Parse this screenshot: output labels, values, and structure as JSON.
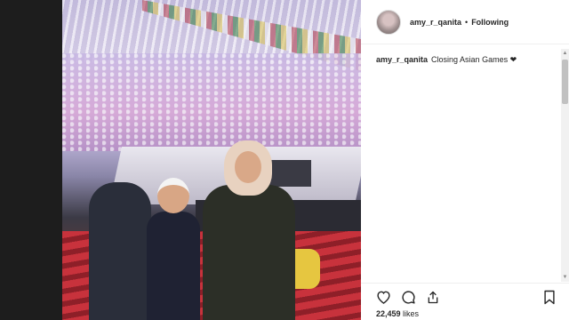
{
  "post": {
    "username": "amy_r_qanita",
    "separator": "•",
    "follow_status": "Following",
    "caption_user": "amy_r_qanita",
    "caption_text": "Closing Asian Games ❤",
    "likes_count": "22,459",
    "likes_label": "likes"
  },
  "icons": {
    "like": "heart-icon",
    "comment": "comment-icon",
    "share": "share-icon",
    "save": "bookmark-icon"
  },
  "colors": {
    "text": "#262626",
    "divider": "#efefef",
    "backdrop": "#1d1d1d"
  }
}
